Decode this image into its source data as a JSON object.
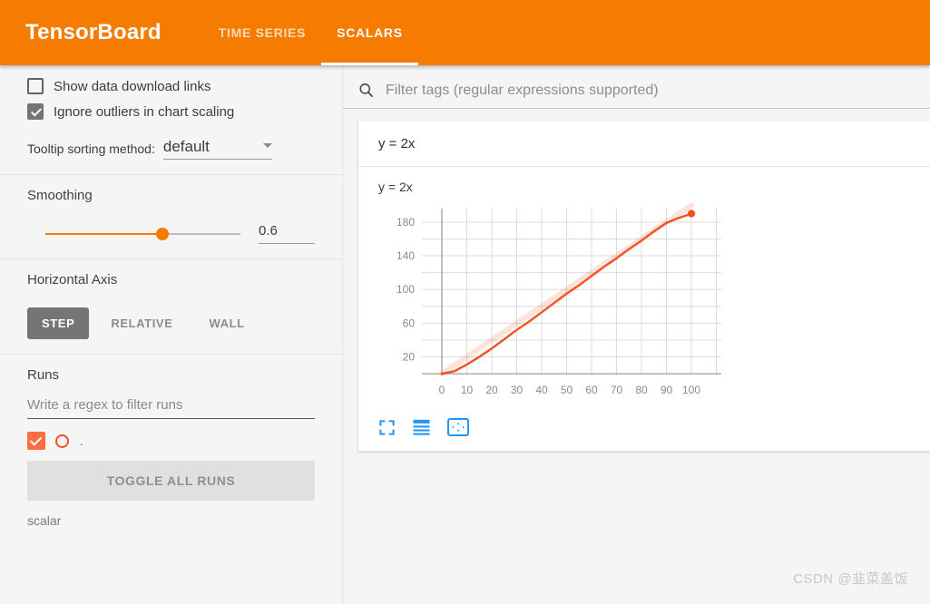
{
  "header": {
    "brand": "TensorBoard",
    "tabs": [
      {
        "label": "TIME SERIES",
        "active": false
      },
      {
        "label": "SCALARS",
        "active": true
      }
    ],
    "accent_color": "#f57c00"
  },
  "sidebar": {
    "settings": {
      "show_download_links": {
        "label": "Show data download links",
        "checked": false
      },
      "ignore_outliers": {
        "label": "Ignore outliers in chart scaling",
        "checked": true
      },
      "tooltip_sorting": {
        "label": "Tooltip sorting method:",
        "value": "default"
      }
    },
    "smoothing": {
      "title": "Smoothing",
      "value": "0.6",
      "percent": 60
    },
    "horizontal_axis": {
      "title": "Horizontal Axis",
      "options": [
        {
          "label": "STEP",
          "active": true
        },
        {
          "label": "RELATIVE",
          "active": false
        },
        {
          "label": "WALL",
          "active": false
        }
      ]
    },
    "runs": {
      "title": "Runs",
      "filter_placeholder": "Write a regex to filter runs",
      "items": [
        {
          "name": ".",
          "checked": true,
          "color": "#ff6e40"
        }
      ],
      "toggle_all_label": "TOGGLE ALL RUNS",
      "footer": "scalar"
    }
  },
  "main": {
    "filter": {
      "placeholder": "Filter tags (regular expressions supported)",
      "value": ""
    },
    "card": {
      "group_title": "y = 2x",
      "chart_tools": [
        "expand-icon",
        "data-table-icon",
        "fit-domain-icon"
      ],
      "tool_color": "#2196f3"
    }
  },
  "chart_data": {
    "type": "line",
    "title": "y = 2x",
    "xlabel": "",
    "ylabel": "",
    "xlim": [
      -8,
      112
    ],
    "ylim": [
      -2,
      196
    ],
    "xticks": [
      0,
      10,
      20,
      30,
      40,
      50,
      60,
      70,
      80,
      90,
      100
    ],
    "yticks": [
      20,
      60,
      100,
      140,
      180
    ],
    "grid": true,
    "legend": false,
    "series": [
      {
        "name": ".",
        "color": "#f4511e",
        "smoothing": 0.6,
        "x": [
          0,
          5,
          10,
          15,
          20,
          25,
          30,
          35,
          40,
          45,
          50,
          55,
          60,
          65,
          70,
          75,
          80,
          85,
          90,
          95,
          100
        ],
        "y": [
          0,
          3,
          11,
          20,
          30,
          41,
          52,
          62,
          73,
          84,
          95,
          105,
          116,
          127,
          137,
          148,
          158,
          169,
          179,
          185,
          190
        ],
        "raw_y": [
          0,
          10,
          20,
          30,
          40,
          50,
          60,
          70,
          80,
          90,
          100,
          110,
          120,
          130,
          140,
          150,
          160,
          170,
          180,
          190,
          200
        ],
        "marker_last": {
          "x": 100,
          "y": 190
        }
      }
    ]
  },
  "watermark": "CSDN @韭菜盖饭"
}
